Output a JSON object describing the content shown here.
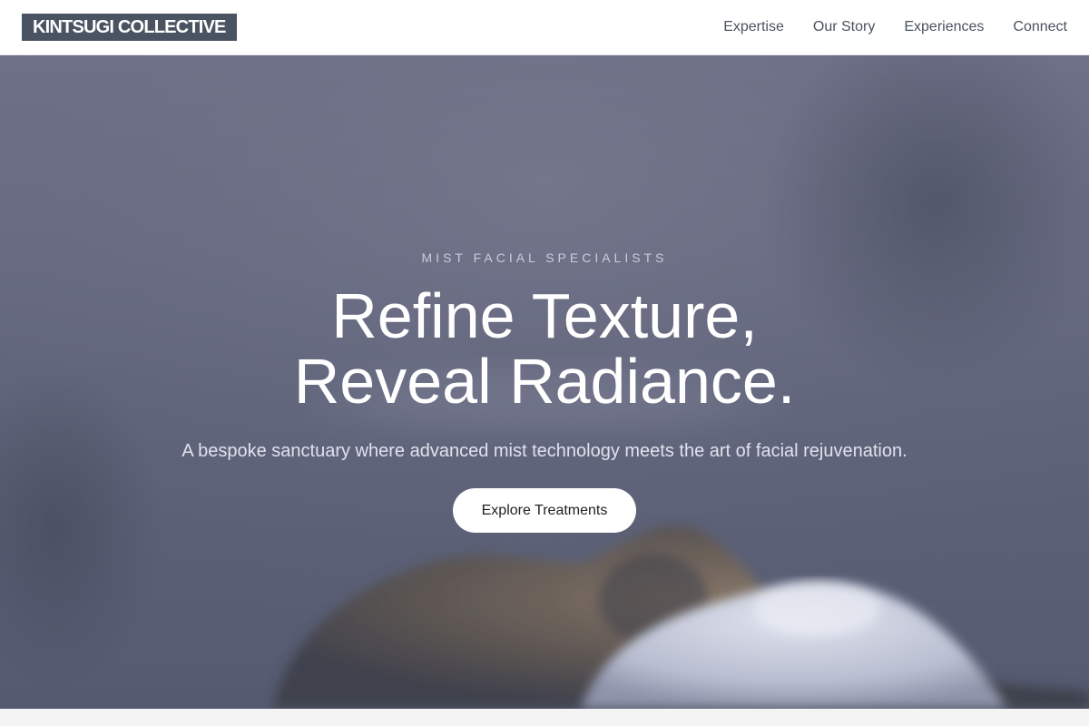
{
  "brand": {
    "logo_text": "KINTSUGI COLLECTIVE"
  },
  "nav": {
    "items": [
      {
        "label": "Expertise"
      },
      {
        "label": "Our Story"
      },
      {
        "label": "Experiences"
      },
      {
        "label": "Connect"
      }
    ]
  },
  "hero": {
    "eyebrow": "MIST FACIAL SPECIALISTS",
    "headline_line1": "Refine Texture,",
    "headline_line2": "Reveal Radiance.",
    "subtitle": "A bespoke sanctuary where advanced mist technology meets the art of facial rejuvenation.",
    "cta_label": "Explore Treatments",
    "background_image": "misty-face-closeup"
  },
  "colors": {
    "logo_bg": "#4a5361",
    "nav_text": "#4a5361",
    "hero_overlay": "#646780",
    "cta_bg": "#ffffff"
  }
}
